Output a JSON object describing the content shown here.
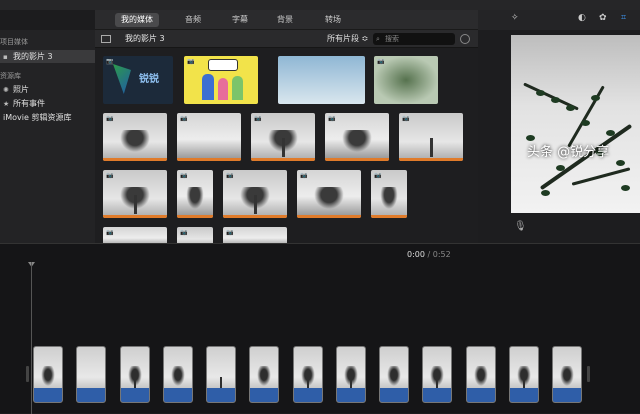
{
  "tabs": {
    "my_media": "我的媒体",
    "audio": "音频",
    "titles": "字幕",
    "backgrounds": "背景",
    "transitions": "转场"
  },
  "sidebar": {
    "project_header": "项目媒体",
    "project_item": "我的影片 3",
    "library_header": "资源库",
    "photos": "照片",
    "all_events": "所有事件",
    "imovie_library": "iMovie 剪辑资源库"
  },
  "browser": {
    "title": "我的影片 3",
    "filter": "所有片段 ≎",
    "search_placeholder": "搜索"
  },
  "logo_text": "锐锐",
  "timeline": {
    "current": "0:00",
    "separator": "/",
    "duration": "0:52"
  },
  "watermark": "头条 @锐分享",
  "colors": {
    "accent_blue": "#3d8fe6",
    "clip_blue": "#2f5ea8",
    "trim_orange": "#e07b2a"
  }
}
